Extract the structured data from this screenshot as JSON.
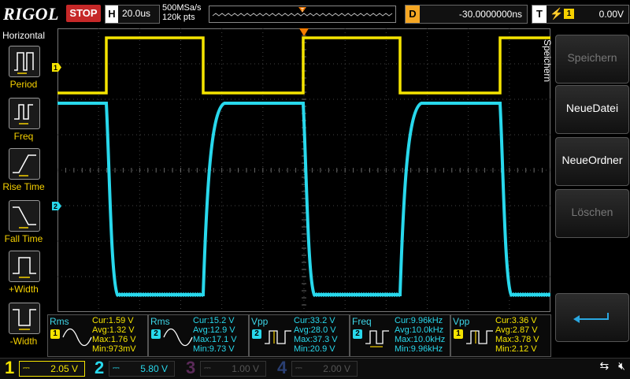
{
  "top_bar": {
    "brand": "RIGOL",
    "run_state": "STOP",
    "timebase": {
      "label": "H",
      "value": "20.0us"
    },
    "sample_rate": "500MSa/s",
    "memory_depth": "120k pts",
    "trigger_marker": "T",
    "delay": {
      "label": "D",
      "value": "-30.0000000ns"
    },
    "trigger": {
      "label": "T",
      "channel": "1",
      "level": "0.00V"
    }
  },
  "left_panel": {
    "title": "Horizontal",
    "items": [
      {
        "label": "Period",
        "icon": "period-icon"
      },
      {
        "label": "Freq",
        "icon": "freq-icon"
      },
      {
        "label": "Rise Time",
        "icon": "rise-time-icon"
      },
      {
        "label": "Fall Time",
        "icon": "fall-time-icon"
      },
      {
        "label": "+Width",
        "icon": "positive-width-icon"
      },
      {
        "label": "-Width",
        "icon": "negative-width-icon"
      }
    ]
  },
  "right_panel": {
    "menu_title": "Speichern",
    "softkeys": [
      {
        "label": "Speichern",
        "enabled": false
      },
      {
        "label": "NeueDatei",
        "enabled": true
      },
      {
        "label": "NeueOrdner",
        "enabled": true
      },
      {
        "label": "Löschen",
        "enabled": false
      }
    ],
    "back_icon": "return-arrow-icon"
  },
  "waveform": {
    "ch1_marker": "1",
    "ch2_marker": "2",
    "ch1_color": "#f5e400",
    "ch2_color": "#28d8ec"
  },
  "measurements": [
    {
      "name": "Rms",
      "channel": "1",
      "color": "#f5e400",
      "icon": "sine-icon",
      "cur": "Cur:1.59 V",
      "avg": "Avg:1.32 V",
      "max": "Max:1.76 V",
      "min": "Min:973mV"
    },
    {
      "name": "Rms",
      "channel": "2",
      "color": "#28d8ec",
      "icon": "sine-icon",
      "cur": "Cur:15.2 V",
      "avg": "Avg:12.9 V",
      "max": "Max:17.1 V",
      "min": "Min:9.73 V"
    },
    {
      "name": "Vpp",
      "channel": "2",
      "color": "#28d8ec",
      "icon": "vpp-icon",
      "cur": "Cur:33.2 V",
      "avg": "Avg:28.0 V",
      "max": "Max:37.3 V",
      "min": "Min:20.9 V"
    },
    {
      "name": "Freq",
      "channel": "2",
      "color": "#28d8ec",
      "icon": "freq-icon",
      "cur": "Cur:9.96kHz",
      "avg": "Avg:10.0kHz",
      "max": "Max:10.0kHz",
      "min": "Min:9.96kHz"
    },
    {
      "name": "Vpp",
      "channel": "1",
      "color": "#f5e400",
      "icon": "vpp-icon",
      "cur": "Cur:3.36 V",
      "avg": "Avg:2.87 V",
      "max": "Max:3.78 V",
      "min": "Min:2.12 V"
    }
  ],
  "channels": [
    {
      "num": "1",
      "scale": "2.05 V",
      "active": true,
      "color": "#f5e400"
    },
    {
      "num": "2",
      "scale": "5.80 V",
      "active": true,
      "color": "#28d8ec"
    },
    {
      "num": "3",
      "scale": "1.00 V",
      "active": false,
      "color": "#c23bbd"
    },
    {
      "num": "4",
      "scale": "2.00 V",
      "active": false,
      "color": "#3f6fe0"
    }
  ]
}
